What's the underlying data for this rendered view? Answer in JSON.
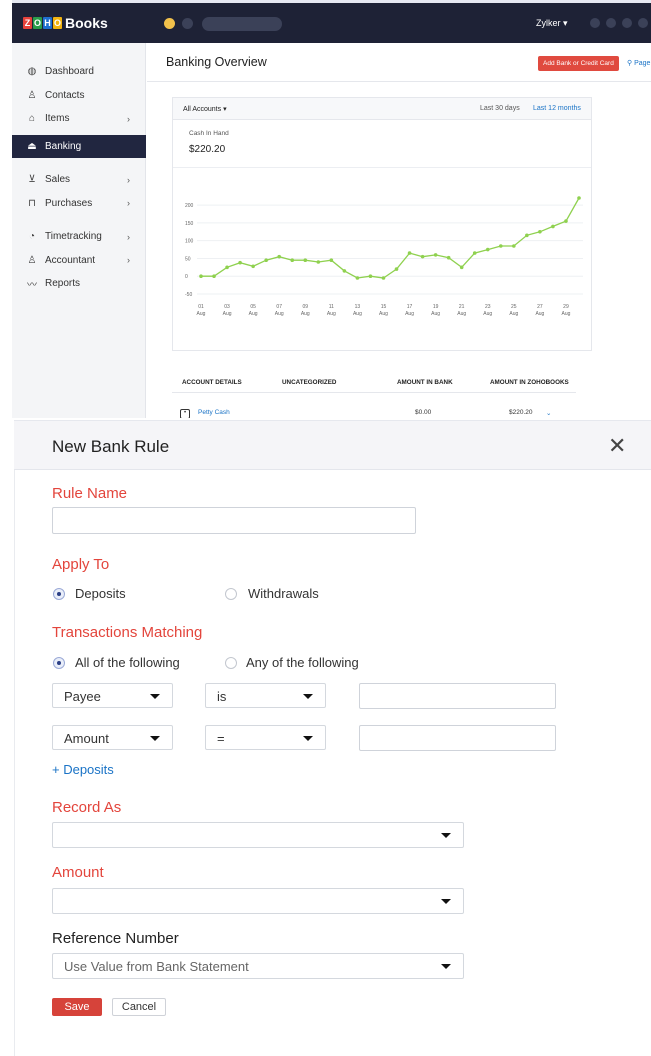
{
  "app": {
    "brand_logo_letters": [
      "Z",
      "O",
      "H",
      "O"
    ],
    "brand_logo_colors": [
      "#e8423b",
      "#2a9c4a",
      "#1e6fd0",
      "#f2b40f"
    ],
    "brand_name": "Books",
    "user_menu": "Zylker ▾",
    "sidebar": {
      "items": [
        {
          "label": "Dashboard",
          "icon": "dashboard-icon"
        },
        {
          "label": "Contacts",
          "icon": "contacts-icon"
        },
        {
          "label": "Items",
          "icon": "items-icon"
        },
        {
          "label": "Banking",
          "icon": "bank-icon"
        },
        {
          "label": "Sales",
          "icon": "cart-icon"
        },
        {
          "label": "Purchases",
          "icon": "bag-icon"
        },
        {
          "label": "Timetracking",
          "icon": "stopwatch-icon"
        },
        {
          "label": "Accountant",
          "icon": "accountant-icon"
        },
        {
          "label": "Reports",
          "icon": "reports-icon"
        }
      ],
      "active": "Banking"
    },
    "main": {
      "title": "Banking Overview",
      "add_button": "Add Bank or Credit Card",
      "page_tips": "Page",
      "account_filter": "All Accounts ▾",
      "period_30": "Last 30 days",
      "period_12": "Last 12 months",
      "cash_in_hand_label": "Cash In Hand",
      "cash_in_hand_value": "$220.20",
      "table_headers": [
        "ACCOUNT DETAILS",
        "UNCATEGORIZED",
        "AMOUNT IN BANK",
        "AMOUNT IN ZOHOBOOKS"
      ],
      "table_row": {
        "account": "Petty Cash",
        "bank": "$0.00",
        "zoho": "$220.20"
      }
    }
  },
  "chart_data": {
    "type": "line",
    "x": [
      "01 Aug",
      "02 Aug",
      "03 Aug",
      "04 Aug",
      "05 Aug",
      "06 Aug",
      "07 Aug",
      "08 Aug",
      "09 Aug",
      "10 Aug",
      "11 Aug",
      "12 Aug",
      "13 Aug",
      "14 Aug",
      "15 Aug",
      "16 Aug",
      "17 Aug",
      "18 Aug",
      "19 Aug",
      "20 Aug",
      "21 Aug",
      "22 Aug",
      "23 Aug",
      "24 Aug",
      "25 Aug",
      "26 Aug",
      "27 Aug",
      "28 Aug",
      "29 Aug",
      "30 Aug"
    ],
    "x_tick_labels": [
      {
        "day": "01",
        "month": "Aug"
      },
      {
        "day": "03",
        "month": "Aug"
      },
      {
        "day": "05",
        "month": "Aug"
      },
      {
        "day": "07",
        "month": "Aug"
      },
      {
        "day": "09",
        "month": "Aug"
      },
      {
        "day": "11",
        "month": "Aug"
      },
      {
        "day": "13",
        "month": "Aug"
      },
      {
        "day": "15",
        "month": "Aug"
      },
      {
        "day": "17",
        "month": "Aug"
      },
      {
        "day": "19",
        "month": "Aug"
      },
      {
        "day": "21",
        "month": "Aug"
      },
      {
        "day": "23",
        "month": "Aug"
      },
      {
        "day": "25",
        "month": "Aug"
      },
      {
        "day": "27",
        "month": "Aug"
      },
      {
        "day": "29",
        "month": "Aug"
      }
    ],
    "values": [
      0,
      0,
      25,
      38,
      28,
      45,
      55,
      45,
      45,
      40,
      45,
      15,
      -5,
      0,
      -5,
      20,
      65,
      55,
      60,
      52,
      25,
      65,
      75,
      85,
      85,
      115,
      125,
      140,
      155,
      220
    ],
    "y_ticks": [
      -50,
      0,
      50,
      100,
      150,
      200
    ],
    "ylim": [
      -50,
      220
    ],
    "grid": true,
    "color": "#8fd14f"
  },
  "modal": {
    "title": "New Bank Rule",
    "rule_name_label": "Rule Name",
    "rule_name_value": "",
    "apply_to_label": "Apply To",
    "apply_deposits": "Deposits",
    "apply_withdrawals": "Withdrawals",
    "matching_label": "Transactions Matching",
    "match_all": "All of the following",
    "match_any": "Any of the following",
    "criteria": [
      {
        "field": "Payee",
        "operator": "is",
        "value": ""
      },
      {
        "field": "Amount",
        "operator": "=",
        "value": ""
      }
    ],
    "add_criteria": "+ Deposits",
    "record_as_label": "Record As",
    "record_as_value": "",
    "amount_label": "Amount",
    "amount_value": "",
    "reference_label": "Reference Number",
    "reference_value": "Use Value from Bank Statement",
    "save": "Save",
    "cancel": "Cancel",
    "accent_color": "#e3453c"
  }
}
